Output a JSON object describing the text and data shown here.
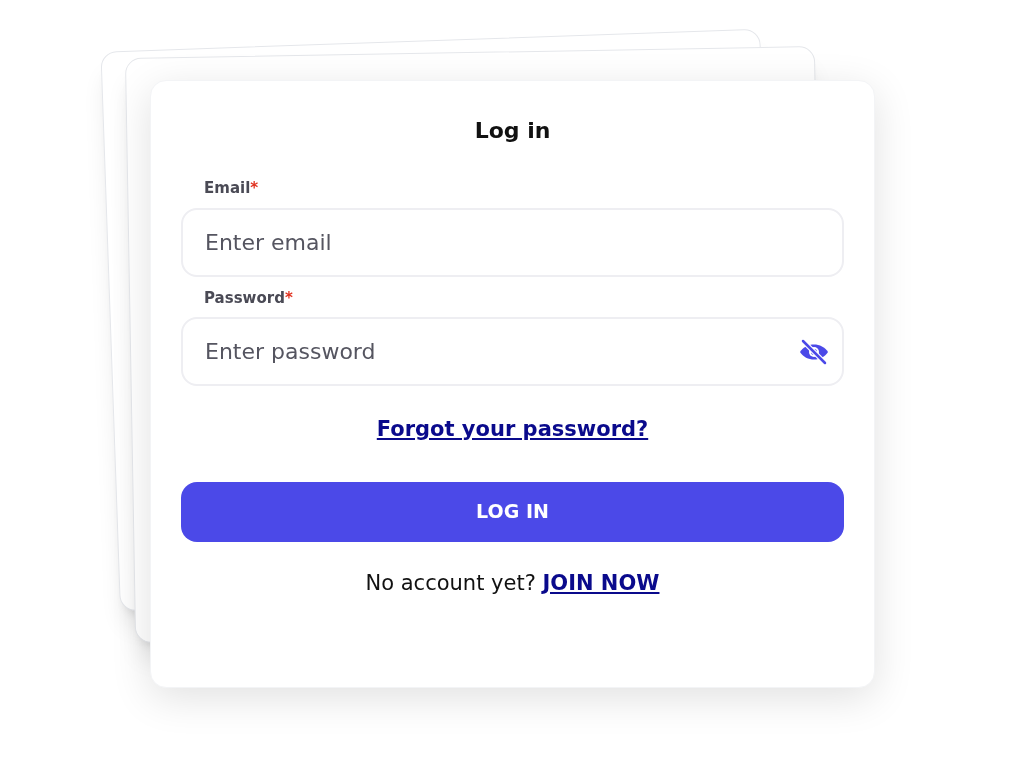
{
  "title": "Log in",
  "fields": [
    {
      "kind": "text",
      "label": "Email",
      "mark": "*",
      "placeholder": "Enter email"
    },
    {
      "kind": "password",
      "label": "Password",
      "mark": "*",
      "placeholder": "Enter password"
    }
  ],
  "forgot_link": "Forgot your password?",
  "submit_button": "LOG IN",
  "signup": {
    "text": "No account yet?",
    "link": "JOIN NOW"
  }
}
